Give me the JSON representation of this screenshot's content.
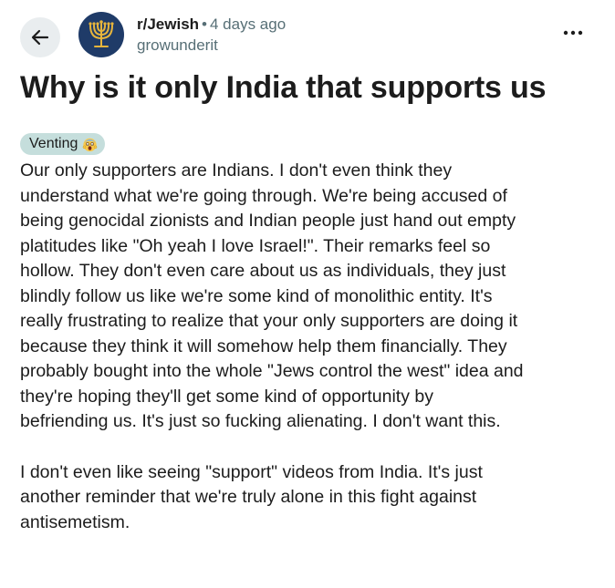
{
  "header": {
    "subreddit": "r/Jewish",
    "separator": "•",
    "time_ago": "4 days ago",
    "author": "growunderit",
    "more_label": "..."
  },
  "post": {
    "title": "Why is it only India that supports us",
    "flair": "Venting",
    "paragraphs": [
      {
        "lines": [
          "Our only supporters are Indians. I don't even think they",
          "understand what we're going through. We're being accused of",
          "being genocidal zionists and Indian people just hand out empty",
          "platitudes like \"Oh yeah I love Israel!\". Their remarks feel so",
          "hollow. They don't even care about us as individuals, they just",
          "blindly follow us like we're some kind of monolithic entity. It's",
          "really frustrating to realize that your only supporters are doing it",
          "because they think it will somehow help them financially. They",
          "probably bought into the whole \"Jews control the west\" idea and",
          "they're hoping they'll get some kind of opportunity by",
          "befriending us. It's just so fucking alienating. I don't want this."
        ]
      },
      {
        "lines": [
          "I don't even like seeing \"support\" videos from India. It's just",
          "another reminder that we're truly alone in this fight against",
          "antisemetism."
        ]
      }
    ]
  },
  "icons": {
    "back": "arrow-left-icon",
    "avatar": "menorah-icon",
    "more": "ellipsis-icon",
    "flair_emoji": "screaming-face-icon"
  },
  "colors": {
    "back_button_bg": "#e9edef",
    "avatar_bg": "#1f3b68",
    "menorah": "#e7b53c",
    "flair_bg": "#c5dedc",
    "muted_text": "#576f76"
  }
}
